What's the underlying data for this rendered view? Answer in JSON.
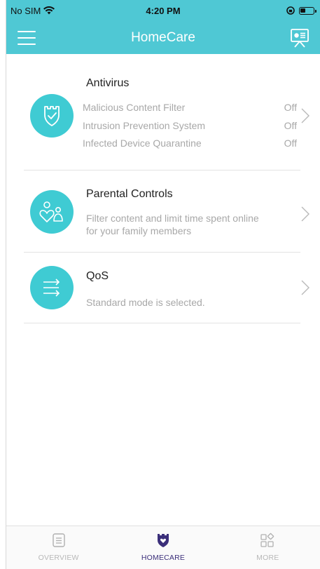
{
  "status_bar": {
    "carrier": "No SIM",
    "time": "4:20 PM"
  },
  "nav": {
    "title": "HomeCare",
    "left_icon": "menu-icon",
    "right_icon": "presentation-icon"
  },
  "colors": {
    "accent": "#4fc8d4",
    "icon_bg": "#3fcbd3",
    "active_tab": "#3b2f7a"
  },
  "cards": {
    "antivirus": {
      "title": "Antivirus",
      "icon": "shield-check-icon",
      "rows": [
        {
          "label": "Malicious Content Filter",
          "value": "Off"
        },
        {
          "label": "Intrusion Prevention System",
          "value": "Off"
        },
        {
          "label": "Infected Device Quarantine",
          "value": "Off"
        }
      ]
    },
    "parental": {
      "title": "Parental Controls",
      "icon": "family-icon",
      "desc_line1": "Filter content and limit time spent online",
      "desc_line2": "for your family members"
    },
    "qos": {
      "title": "QoS",
      "icon": "arrows-icon",
      "desc": "Standard mode is selected."
    }
  },
  "tabs": [
    {
      "label": "OVERVIEW",
      "icon": "document-icon",
      "active": false
    },
    {
      "label": "HOMECARE",
      "icon": "shield-heart-icon",
      "active": true
    },
    {
      "label": "MORE",
      "icon": "grid-icon",
      "active": false
    }
  ]
}
